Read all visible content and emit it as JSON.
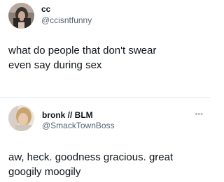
{
  "tweets": [
    {
      "display_name": "cc",
      "handle": "@ccisntfunny",
      "text": "what do people that don't swear\neven say during sex"
    },
    {
      "display_name": "bronk // BLM",
      "handle": "@SmackTownBoss",
      "text": "aw, heck. goodness gracious. great\ngoogily moogily",
      "more_icon": "more-options-icon"
    }
  ],
  "colors": {
    "text": "#0f1419",
    "secondary": "#536471",
    "divider": "#e6ecf0"
  }
}
